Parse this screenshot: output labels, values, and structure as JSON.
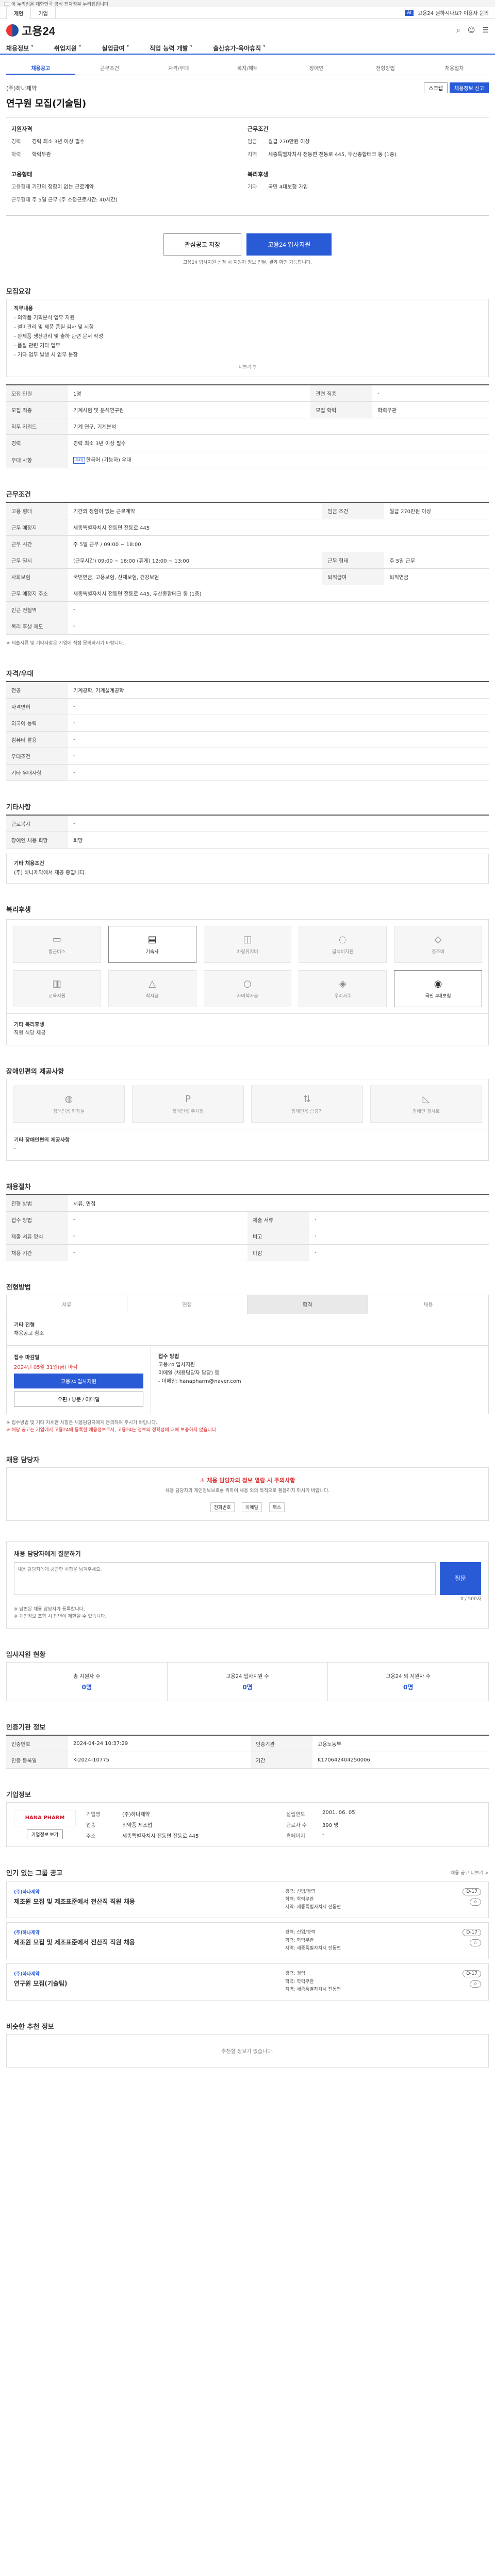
{
  "gov_banner": "이 누리집은 대한민국 공식 전자정부 누리집입니다.",
  "topbar": {
    "tabs": [
      "개인",
      "기업"
    ],
    "right_badge": "AI",
    "right_text": "고용24 원하시나요? 이용자 문의"
  },
  "header": {
    "logo": "고용24"
  },
  "gnb": [
    "채용정보",
    "취업지원",
    "실업급여",
    "직업 능력 개발",
    "출산휴가·육아휴직"
  ],
  "subtabs": [
    "채용공고",
    "근무조건",
    "자격/우대",
    "복지/혜택",
    "장애인",
    "전형방법",
    "채용절차"
  ],
  "job": {
    "company": "(주)하나제약",
    "title": "연구원 모집(기술팀)",
    "report_btn": "채용정보 신고",
    "share_btn": "스크랩"
  },
  "summary": {
    "left_title": "지원자격",
    "left": [
      {
        "k": "경력",
        "v": "경력 최소 3년 이상 필수"
      },
      {
        "k": "학력",
        "v": "학력무관"
      }
    ],
    "left2_title": "고용형태",
    "left2": [
      {
        "k": "고용형태",
        "v": "기간의 정함이 없는 근로계약"
      },
      {
        "k": "근무형태",
        "v": "주 5일 근무 (주 소정근로시간: 40시간)"
      }
    ],
    "right_title": "근무조건",
    "right": [
      {
        "k": "임금",
        "v": "월급 270만원 이상"
      },
      {
        "k": "지역",
        "v": "세종특별자치시 전동면 전동로 445, 두산종합테크 동 (1층)"
      }
    ],
    "right2_title": "복리후생",
    "right2": [
      {
        "k": "기타",
        "v": "국민 4대보험 가입"
      }
    ]
  },
  "actions": {
    "interest": "관심공고 저장",
    "apply": "고용24 입사지원",
    "note": "고용24 입사지원 신청 시 지원자 정보 전달, 결과 확인 가능합니다."
  },
  "s1": {
    "title": "모집요강",
    "duty_title": "직무내용",
    "duty": [
      "- 의약품 기획분석 업무 지원",
      "- 설비관리 및 제품 품질 검사 및 시험",
      "- 완제품 생산관리 및 출하 관련 문서 작성",
      "- 품질 관련 기타 업무",
      "- 기타 업무 발생 시 업무 분장"
    ],
    "more": "더보기 ▽",
    "rows": [
      {
        "k": "모집 인원",
        "v": "1명"
      },
      {
        "k": "모집 직종",
        "v": "기계시험 및 분석연구원"
      },
      {
        "k": "직무 키워드",
        "v": "기계 연구, 기계분석"
      },
      {
        "k": "경력",
        "v": "경력 최소 3년 이상 필수"
      },
      {
        "k": "우대 사항",
        "v": "한국어 (가능자) 우대"
      }
    ],
    "rows_r": [
      {
        "k": "관련 직종",
        "v": "-"
      },
      {
        "k": "모집 학력",
        "v": "학력무관"
      }
    ]
  },
  "s2": {
    "title": "근무조건",
    "rows": [
      {
        "k": "고용 형태",
        "v": "기간의 정함이 없는 근로계약",
        "k2": "임금 조건",
        "v2": "월급 270만원 이상"
      },
      {
        "k": "근무 예정지",
        "v": "세종특별자치시 전동면 전동로 445"
      },
      {
        "k": "근무 시간",
        "v": "주 5일 근무 / 09:00 ~ 18:00"
      },
      {
        "k": "근무 일시",
        "v": "(근무시간) 09:00 ~ 18:00 (휴게) 12:00 ~ 13:00",
        "k2": "근무 형태",
        "v2": "주 5일 근무"
      },
      {
        "k": "사회보험",
        "v": "국민연금, 고용보험, 산재보험, 건강보험",
        "k2": "퇴직급여",
        "v2": "퇴직연금"
      },
      {
        "k": "근무 예정지 주소",
        "v": "세종특별자치시 전동면 전동로 445, 두산종합테크 동 (1층)"
      },
      {
        "k": "인근 전철역",
        "v": "-"
      },
      {
        "k": "복리 후생 제도",
        "v": "-"
      }
    ],
    "note": "※ 제출서류 및 기타사항은 기업에 직접 문의하시기 바랍니다."
  },
  "s3": {
    "title": "자격/우대",
    "rows": [
      {
        "k": "전공",
        "v": "기계공학, 기계설계공학"
      },
      {
        "k": "자격면허",
        "v": "-"
      },
      {
        "k": "외국어 능력",
        "v": "-"
      },
      {
        "k": "컴퓨터 활용",
        "v": "-"
      },
      {
        "k": "우대조건",
        "v": "-"
      },
      {
        "k": "기타 우대사항",
        "v": "-"
      }
    ]
  },
  "s4": {
    "title": "기타사항",
    "rows": [
      {
        "k": "근로복지",
        "v": "-"
      },
      {
        "k": "장애인 채용 희망",
        "v": "희망"
      }
    ],
    "etc_title": "기타 채용조건",
    "etc": "(주) 하나제약에서 제공 중입니다."
  },
  "s5": {
    "title": "복리후생",
    "items": [
      "통근버스",
      "기숙사",
      "차량유지비",
      "급식비지원",
      "경조비",
      "교육지원",
      "학자금",
      "자녀학자금",
      "우리사주",
      "국민 4대보험"
    ],
    "active": [
      1,
      9
    ],
    "etc_label": "기타 복리후생",
    "etc": "직원 식당 제공"
  },
  "s6": {
    "title": "장애인편의 제공사항",
    "items": [
      "장애인용 화장실",
      "장애인용 주차장",
      "장애인용 승강기",
      "장애인 경사로"
    ],
    "etc_label": "기타 장애인편의 제공사항",
    "etc": "-"
  },
  "s7": {
    "title": "채용절차",
    "rows": [
      {
        "k": "전형 방법",
        "v": "서류, 면접"
      },
      {
        "k": "접수 방법",
        "v": "-",
        "k2": "제출 서류",
        "v2": "-"
      },
      {
        "k": "제출 서류 양식",
        "v": "-",
        "k2": "비고",
        "v2": "-"
      },
      {
        "k": "채용 기간",
        "v": "-",
        "k2": "마감",
        "v2": "-"
      }
    ]
  },
  "s8": {
    "title": "전형방법",
    "steps": [
      "서류",
      "면접",
      "합격",
      "채용"
    ],
    "active_step": 2,
    "extra_title": "기타 전형",
    "extra": "채용공고 참조",
    "apply_l_title": "접수 마감일",
    "apply_l_date": "2024년 05월 31일(금) 마감",
    "apply_btn1": "고용24 입사지원",
    "apply_btn2": "우편 / 방문 / 이메일",
    "apply_r_title": "접수 방법",
    "apply_r": [
      "고용24 입사지원",
      "이메일 (채용담당자 담당) 등",
      "- 이메일: hanapharm@naver.com"
    ],
    "fnote": [
      "※ 접수방법 및 기타 자세한 사항은 채용담당자에게 문의하여 주시기 바랍니다.",
      "※ 해당 공고는 기업에서 고용24에 등록한 채용정보로서, 고용24는 정보의 정확성에 대해 보증하지 않습니다."
    ]
  },
  "s9": {
    "title": "채용 담당자",
    "warn": "채용 담당자의 정보 열람 시 주의사항",
    "p": "채용 담당자의 개인정보보호를 위하여 채용 외의 목적으로 활용하지 마시기 바랍니다.",
    "recv": [
      "전화번호",
      "이메일",
      "팩스"
    ]
  },
  "s10": {
    "title": "채용 담당자에게 질문하기",
    "placeholder": "채용 담당자에게 궁금한 사항을 남겨주세요.",
    "counter": "0 / 500자",
    "btn": "질문",
    "notes": [
      "※ 답변은 채용 담당자가 등록합니다.",
      "※ 개인정보 포함 시 답변이 제한될 수 있습니다."
    ]
  },
  "s11": {
    "title": "입사지원 현황",
    "stats": [
      {
        "k": "총 지원자 수",
        "v": "0명"
      },
      {
        "k": "고용24 입사지원 수",
        "v": "0명"
      },
      {
        "k": "고용24 외 지원자 수",
        "v": "0명"
      }
    ]
  },
  "s12": {
    "title": "인증기관 정보",
    "rows": [
      {
        "k": "인증번호",
        "v": "2024-04-24 10:37:29",
        "k2": "인증기관",
        "v2": "고용노동부"
      },
      {
        "k": "인증 등록일",
        "v": "K-2024-10775",
        "k2": "기간",
        "v2": "K170642404250006"
      }
    ]
  },
  "s13": {
    "title": "기업정보",
    "logo": "HANA PHARM",
    "btn": "기업정보 보기",
    "grid": [
      {
        "k": "기업명",
        "v": "(주)하나제약"
      },
      {
        "k": "설립연도",
        "v": "2001. 06. 05"
      },
      {
        "k": "업종",
        "v": "의약품 제조업"
      },
      {
        "k": "근로자 수",
        "v": "390 명"
      },
      {
        "k": "주소",
        "v": "세종특별자치시 전동면 전동로 445"
      },
      {
        "k": "홈페이지",
        "v": "-"
      }
    ]
  },
  "s14": {
    "title": "인기 있는 그룹 공고",
    "right": "채용 공고 더보기 >",
    "cards": [
      {
        "company": "(주)하나제약",
        "title": "제조원 모집 및 제조표준에서 전산직 직원 채용",
        "m": [
          "경력: 신입/경력",
          "학력: 학력무관",
          "지역: 세종특별자치시 전동면"
        ],
        "tag": "D-17"
      },
      {
        "company": "(주)하나제약",
        "title": "제조원 모집 및 제조표준에서 전산직 직원 채용",
        "m": [
          "경력: 신입/경력",
          "학력: 학력무관",
          "지역: 세종특별자치시 전동면"
        ],
        "tag": "D-17"
      },
      {
        "company": "(주)하나제약",
        "title": "연구원 모집(기술팀)",
        "m": [
          "경력: 경력",
          "학력: 학력무관",
          "지역: 세종특별자치시 전동면"
        ],
        "tag": "D-17"
      }
    ]
  },
  "s15": {
    "title": "비슷한 추천 정보",
    "empty": "추천할 정보가 없습니다."
  }
}
